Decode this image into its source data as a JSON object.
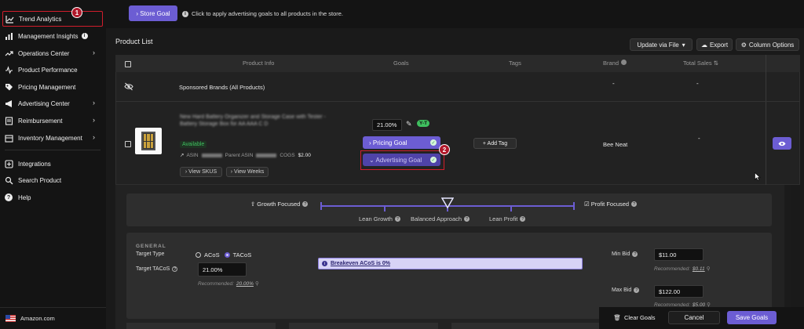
{
  "sidebar": {
    "items": [
      {
        "label": "Trend Analytics",
        "badge": "1"
      },
      {
        "label": "Management Insights"
      },
      {
        "label": "Operations Center"
      },
      {
        "label": "Product Performance"
      },
      {
        "label": "Pricing Management"
      },
      {
        "label": "Advertising Center"
      },
      {
        "label": "Reimbursement"
      },
      {
        "label": "Inventory Management"
      },
      {
        "label": "Integrations"
      },
      {
        "label": "Search Product"
      },
      {
        "label": "Help"
      }
    ],
    "store": "Amazon.com"
  },
  "banner": {
    "store_goal_button": "› Store Goal",
    "hint": "Click to apply advertising goals to all products in the store."
  },
  "product_list": {
    "title": "Product List",
    "update_via_file": "Update via File",
    "export": "Export",
    "column_options": "Column Options",
    "columns": [
      "Product Info",
      "Goals",
      "Tags",
      "Brand",
      "Total Sales"
    ],
    "sponsored_row": {
      "label": "Sponsored Brands (All Products)",
      "brand": "-",
      "sales": "-"
    },
    "product": {
      "title_blur": "New Hard Battery Organizer and Storage Case with Tester - Battery Storage Box for AA AAA C D",
      "status": "Available",
      "asin_label": "ASIN",
      "parent_asin_label": "Parent ASIN",
      "cogs_label": "COGS",
      "cogs_value": "$2.00",
      "view_skus": "› View SKUS",
      "view_weeks": "› View Weeks",
      "goal_value": "21.00%",
      "goal_tag": "Y-T",
      "pricing_goal": "› Pricing Goal",
      "advertising_goal": "⌄ Advertising Goal",
      "advertising_badge": "2",
      "add_tag": "+ Add Tag",
      "brand": "Bee Neat",
      "sales": "-"
    }
  },
  "goal_slider": {
    "growth": "Growth Focused",
    "profit": "Profit Focused",
    "lean_growth": "Lean Growth",
    "balanced": "Balanced Approach",
    "lean_profit": "Lean Profit"
  },
  "general": {
    "section": "GENERAL",
    "target_type_label": "Target Type",
    "acos": "ACoS",
    "tacos": "TACoS",
    "target_tacos_label": "Target TACoS",
    "target_tacos_value": "21.00%",
    "recommended_label": "Recommended:",
    "recommended_value": "20.00%",
    "breakeven": "Breakeven ACoS is 0%",
    "min_bid_label": "Min Bid",
    "min_bid_value": "$11.00",
    "min_recommended": "$0.11",
    "max_bid_label": "Max Bid",
    "max_bid_value": "$122.00",
    "max_recommended": "$5.00"
  },
  "footer": {
    "clear_goals": "Clear Goals",
    "cancel": "Cancel",
    "save_goals": "Save Goals"
  },
  "colors": {
    "accent": "#6c5dd3",
    "highlight": "#d11d2c",
    "available": "#3fbf5f"
  }
}
